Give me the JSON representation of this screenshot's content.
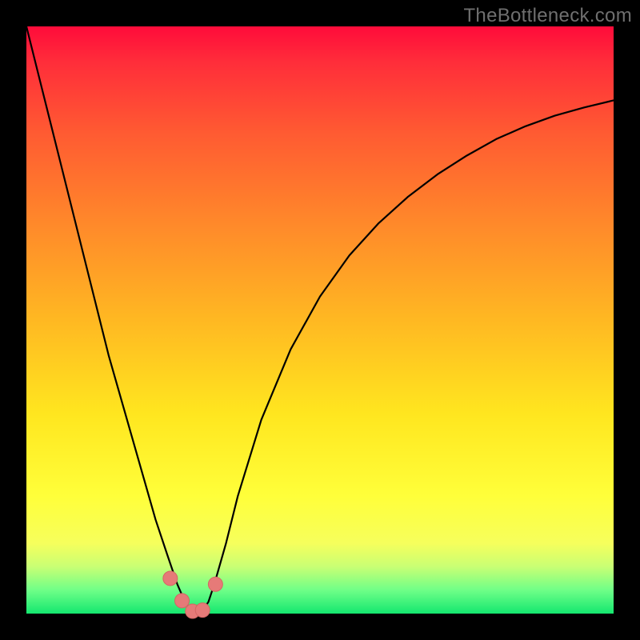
{
  "watermark": "TheBottleneck.com",
  "colors": {
    "frame": "#000000",
    "curve_stroke": "#000000",
    "marker_fill": "#e67a78",
    "marker_stroke": "#d46663"
  },
  "chart_data": {
    "type": "line",
    "title": "",
    "xlabel": "",
    "ylabel": "",
    "xlim": [
      0,
      1
    ],
    "ylim": [
      0,
      1
    ],
    "x": [
      0.0,
      0.02,
      0.04,
      0.06,
      0.08,
      0.1,
      0.12,
      0.14,
      0.16,
      0.18,
      0.2,
      0.22,
      0.24,
      0.257,
      0.27,
      0.28,
      0.29,
      0.3,
      0.31,
      0.32,
      0.34,
      0.36,
      0.4,
      0.45,
      0.5,
      0.55,
      0.6,
      0.65,
      0.7,
      0.75,
      0.8,
      0.85,
      0.9,
      0.95,
      1.0
    ],
    "values": [
      1.0,
      0.92,
      0.84,
      0.76,
      0.68,
      0.6,
      0.52,
      0.44,
      0.37,
      0.3,
      0.23,
      0.16,
      0.1,
      0.05,
      0.02,
      0.005,
      0.0,
      0.005,
      0.02,
      0.05,
      0.12,
      0.2,
      0.33,
      0.45,
      0.54,
      0.61,
      0.665,
      0.71,
      0.748,
      0.78,
      0.808,
      0.83,
      0.848,
      0.862,
      0.874
    ],
    "markers": {
      "x": [
        0.245,
        0.265,
        0.283,
        0.3,
        0.322
      ],
      "y": [
        0.06,
        0.022,
        0.004,
        0.006,
        0.05
      ]
    },
    "series": [
      {
        "name": "bottleneck-curve",
        "color": "#000000"
      }
    ]
  }
}
